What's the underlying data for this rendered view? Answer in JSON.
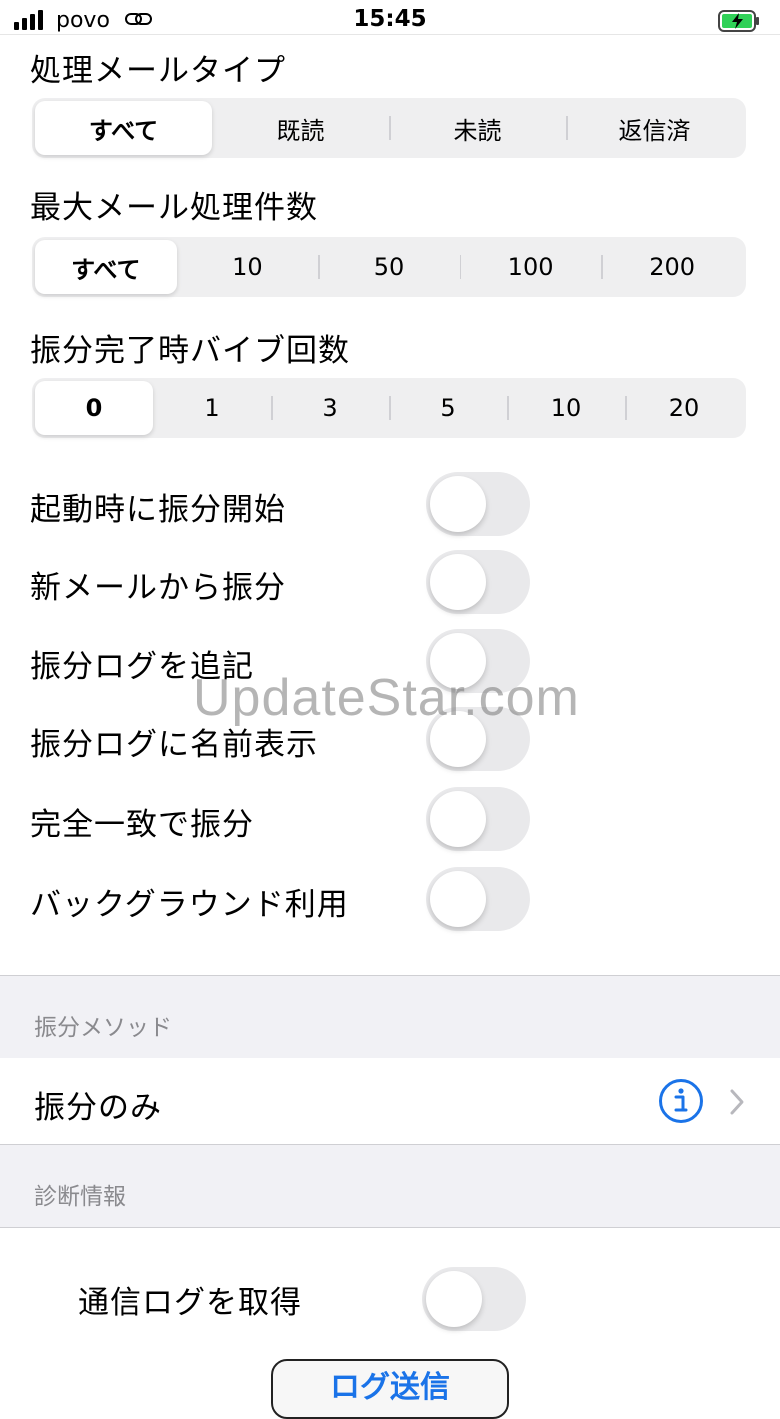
{
  "status_bar": {
    "carrier": "povo",
    "time": "15:45"
  },
  "mail_type": {
    "title": "処理メールタイプ",
    "options": [
      "すべて",
      "既読",
      "未読",
      "返信済"
    ],
    "selected": "すべて"
  },
  "max_mail": {
    "title": "最大メール処理件数",
    "options": [
      "すべて",
      "10",
      "50",
      "100",
      "200"
    ],
    "selected": "すべて"
  },
  "vibrate_count": {
    "title": "振分完了時バイブ回数",
    "options": [
      "0",
      "1",
      "3",
      "5",
      "10",
      "20"
    ],
    "selected": "0"
  },
  "toggles": [
    {
      "label": "起動時に振分開始",
      "on": false
    },
    {
      "label": "新メールから振分",
      "on": false
    },
    {
      "label": "振分ログを追記",
      "on": false
    },
    {
      "label": "振分ログに名前表示",
      "on": false
    },
    {
      "label": "完全一致で振分",
      "on": false
    },
    {
      "label": "バックグラウンド利用",
      "on": false
    }
  ],
  "method_section": {
    "header": "振分メソッド",
    "value": "振分のみ"
  },
  "diagnostics": {
    "header": "診断情報",
    "comm_log_label": "通信ログを取得",
    "comm_log_on": false,
    "send_button": "ログ送信"
  },
  "watermark": "UpdateStar.com",
  "colors": {
    "accent": "#1a73e8",
    "toggle_off": "#e9e9eb",
    "group_bg": "#f1f1f5"
  },
  "icons": [
    "signal-icon",
    "link-icon",
    "battery-charging-icon",
    "info-icon",
    "chevron-right-icon"
  ]
}
